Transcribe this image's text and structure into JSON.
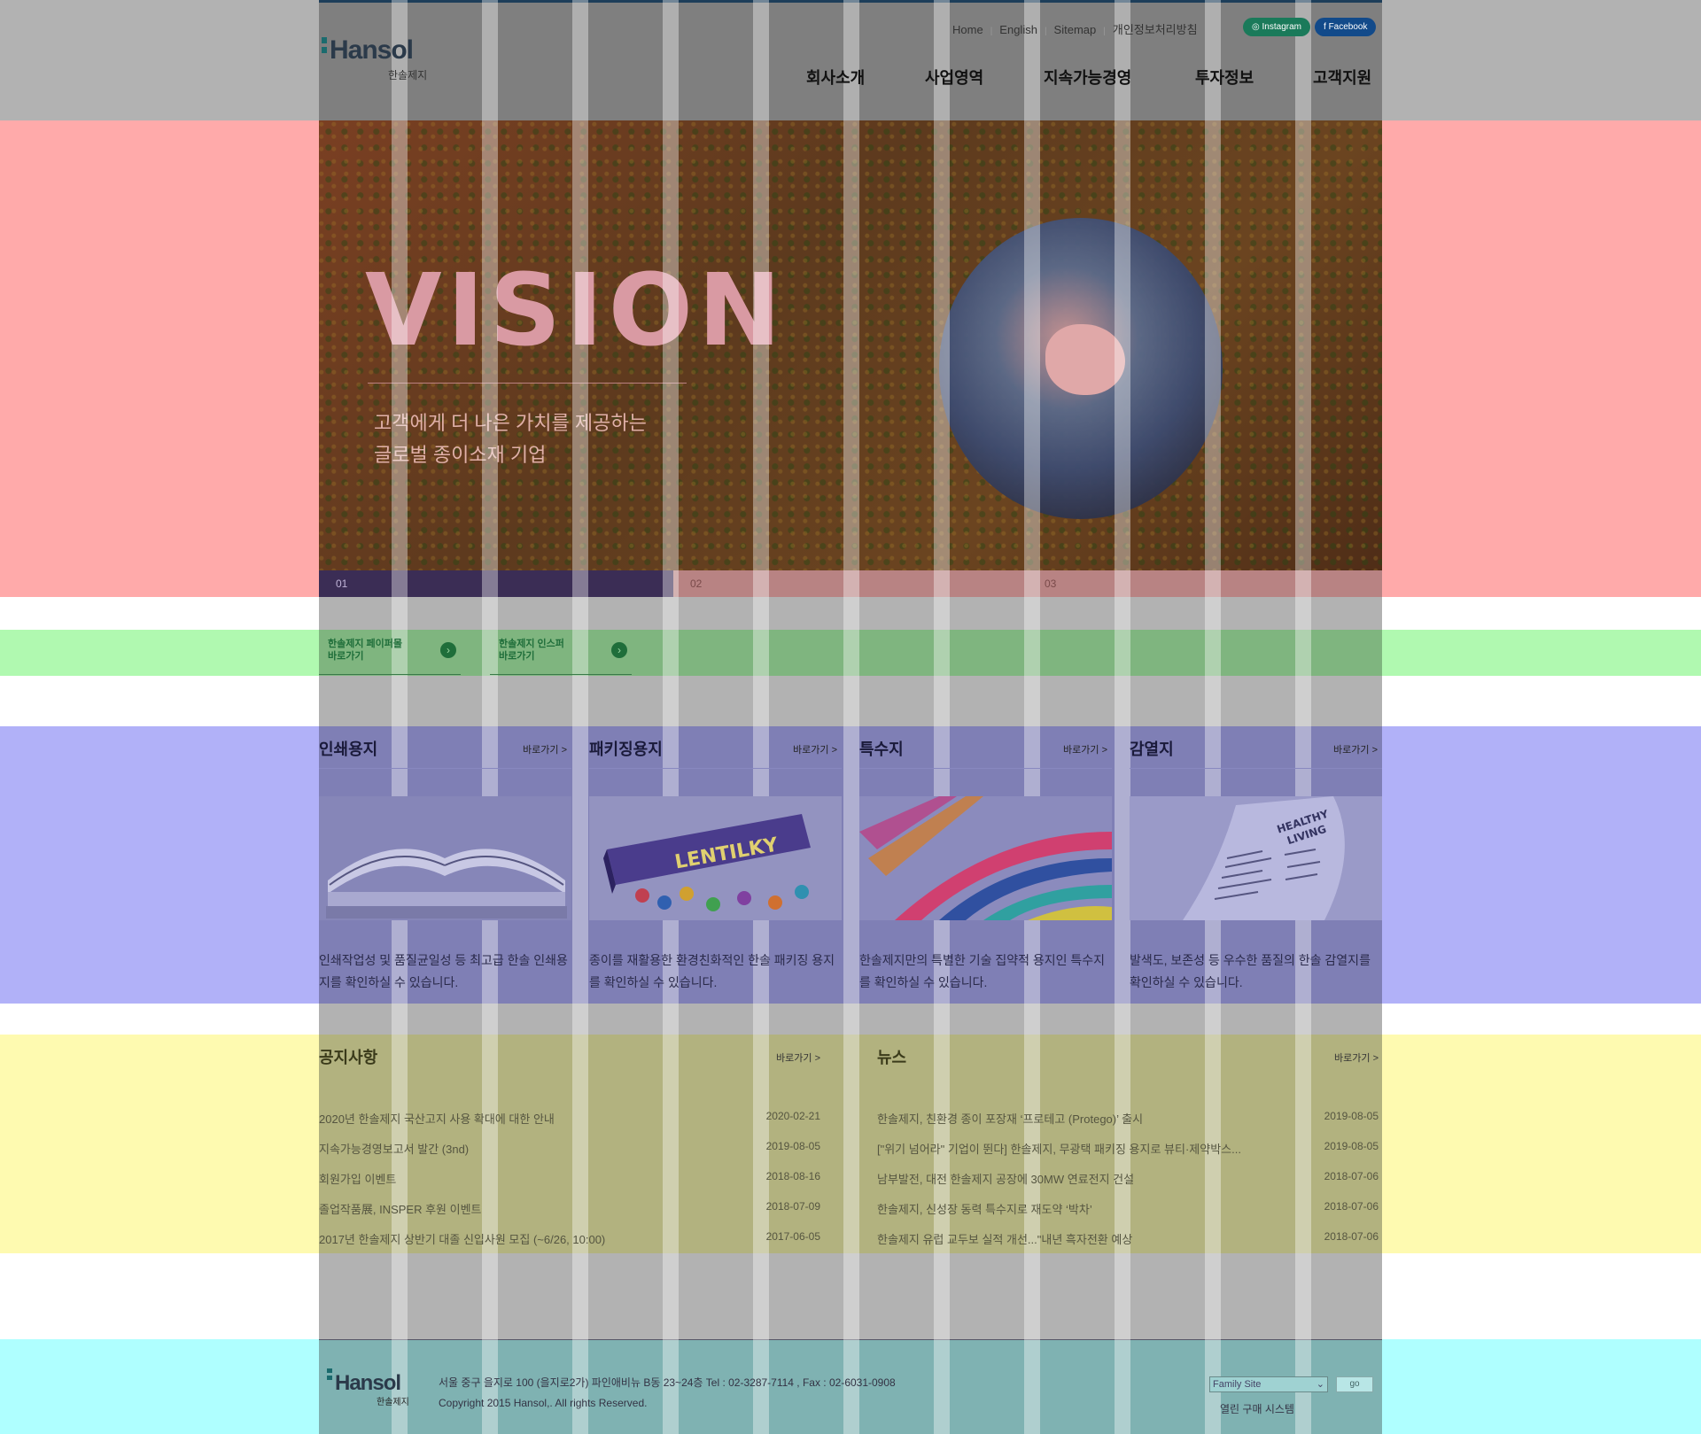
{
  "header": {
    "logo_text": "Hansol",
    "logo_sub": "한솔제지",
    "util_links": [
      "Home",
      "English",
      "Sitemap",
      "개인정보처리방침"
    ],
    "sns": {
      "instagram": "Instagram",
      "facebook": "Facebook"
    },
    "gnb": [
      "회사소개",
      "사업영역",
      "지속가능경영",
      "투자정보",
      "고객지원"
    ]
  },
  "hero": {
    "title": "VISION",
    "subtitle_line1": "고객에게 더 나은 가치를 제공하는",
    "subtitle_line2": "글로벌 종이소재 기업",
    "tabs": [
      "01",
      "02",
      "03"
    ],
    "active_tab": "01"
  },
  "quick_links": [
    {
      "line1": "한솔제지 페이퍼몰",
      "line2": "바로가기"
    },
    {
      "line1": "한솔제지 인스퍼",
      "line2": "바로가기"
    }
  ],
  "categories": [
    {
      "title": "인쇄용지",
      "more": "바로가기 >",
      "desc": "인쇄작업성 및 품질균일성 등 최고급 한솔 인쇄용지를 확인하실 수 있습니다."
    },
    {
      "title": "패키징용지",
      "more": "바로가기 >",
      "desc": "종이를 재활용한 환경친화적인 한솔 패키징 용지를 확인하실 수 있습니다."
    },
    {
      "title": "특수지",
      "more": "바로가기 >",
      "desc": "한솔제지만의 특별한 기술 집약적 용지인 특수지를 확인하실 수 있습니다."
    },
    {
      "title": "감열지",
      "more": "바로가기 >",
      "desc": "발색도, 보존성 등 우수한 품질의 한솔 감열지를 확인하실 수 있습니다."
    }
  ],
  "images": {
    "candy_text": "LENTILKY",
    "receipt_text1": "HEALTHY",
    "receipt_text2": "LIVING"
  },
  "notice": {
    "title": "공지사항",
    "more": "바로가기 >",
    "items": [
      {
        "title": "2020년 한솔제지 국산고지 사용 확대에 대한 안내",
        "date": "2020-02-21"
      },
      {
        "title": "지속가능경영보고서 발간 (3nd)",
        "date": "2019-08-05"
      },
      {
        "title": "회원가입 이벤트",
        "date": "2018-08-16"
      },
      {
        "title": "졸업작품展, INSPER 후원 이벤트",
        "date": "2018-07-09"
      },
      {
        "title": "2017년 한솔제지 상반기 대졸 신입사원 모집 (~6/26, 10:00)",
        "date": "2017-06-05"
      }
    ]
  },
  "news": {
    "title": "뉴스",
    "more": "바로가기 >",
    "items": [
      {
        "title": "한솔제지, 친환경 종이 포장재 ‘프로테고 (Protego)’ 출시",
        "date": "2019-08-05"
      },
      {
        "title": "[\"위기 넘어라\" 기업이 뛴다] 한솔제지, 무광택 패키징 용지로 뷰티·제약박스...",
        "date": "2019-08-05"
      },
      {
        "title": "남부발전, 대전 한솔제지 공장에 30MW 연료전지 건설",
        "date": "2018-07-06"
      },
      {
        "title": "한솔제지, 신성장 동력 특수지로 재도약 ‘박차’",
        "date": "2018-07-06"
      },
      {
        "title": "한솔제지 유럽 교두보 실적 개선...\"내년 흑자전환 예상",
        "date": "2018-07-06"
      }
    ]
  },
  "footer": {
    "logo_text": "Hansol",
    "logo_sub": "한솔제지",
    "address": "서울 중구 을지로 100 (을지로2가) 파인애비뉴 B동 23~24층 Tel : 02-3287-7114 , Fax : 02-6031-0908",
    "copyright": "Copyright 2015 Hansol,. All rights Reserved.",
    "family_site": "Family Site",
    "go": "go",
    "open_purchase": "열린 구매 시스템"
  }
}
